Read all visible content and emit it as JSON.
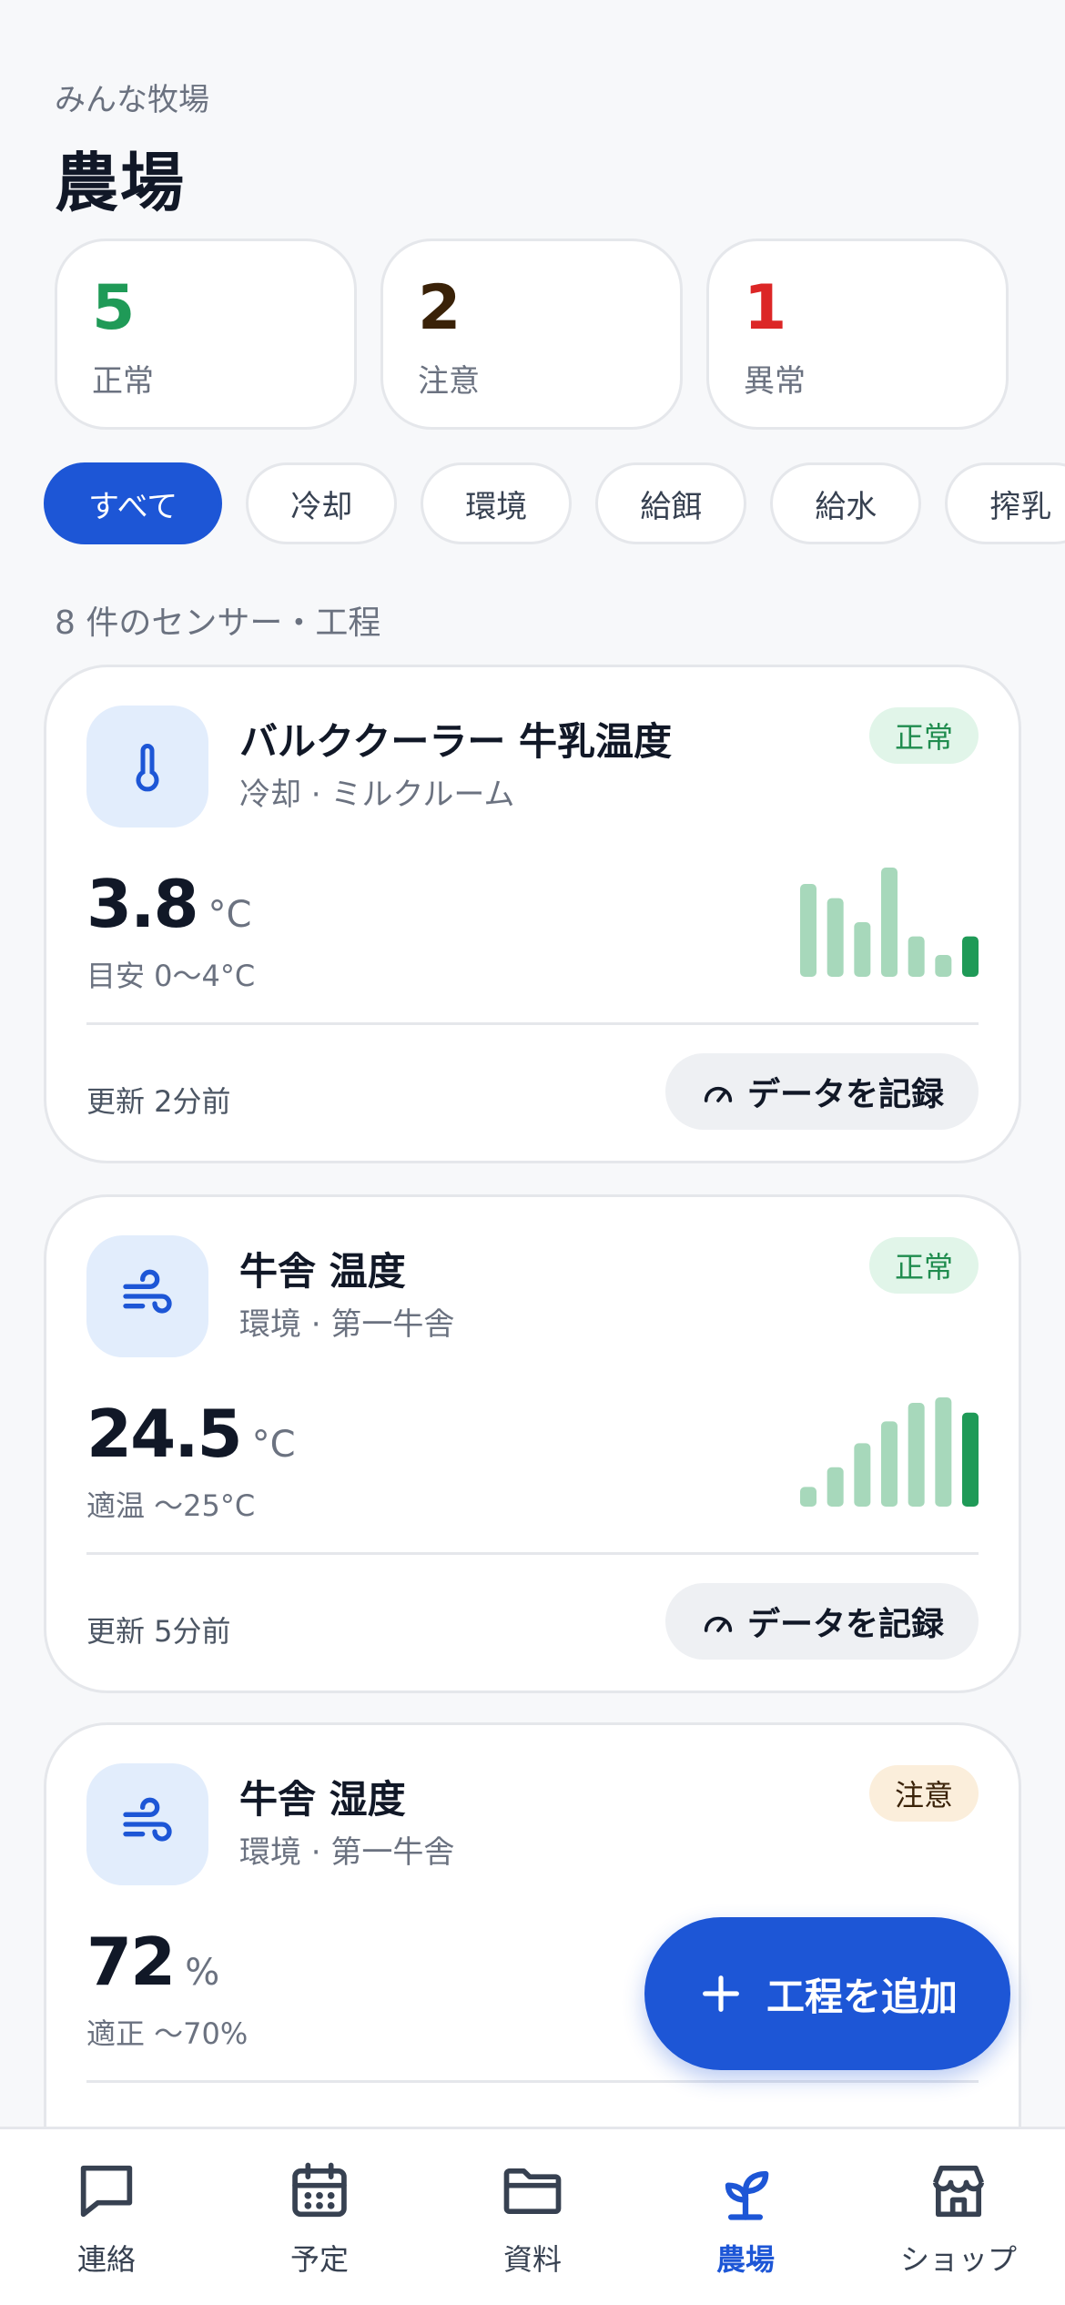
{
  "header": {
    "org": "みんな牧場",
    "title": "農場"
  },
  "stats": [
    {
      "value": "5",
      "label": "正常",
      "color": "#1f9a57"
    },
    {
      "value": "2",
      "label": "注意",
      "color": "#3a2208"
    },
    {
      "value": "1",
      "label": "異常",
      "color": "#dc2626"
    }
  ],
  "filters": [
    "すべて",
    "冷却",
    "環境",
    "給餌",
    "給水",
    "搾乳"
  ],
  "active_filter": "すべて",
  "count_label": "8 件のセンサー・工程",
  "cards": [
    {
      "icon": "thermometer-icon",
      "name": "バルククーラー 牛乳温度",
      "sub": "冷却 · ミルクルーム",
      "status": "正常",
      "status_kind": "ok",
      "value": "3.8",
      "unit": "°C",
      "range": "目安 0〜4°C",
      "trend": [
        0.85,
        0.72,
        0.5,
        1.0,
        0.37,
        0.2,
        0.37
      ],
      "updated": "更新 2分前",
      "action": "データを記録"
    },
    {
      "icon": "wind-icon",
      "name": "牛舎 温度",
      "sub": "環境 · 第一牛舎",
      "status": "正常",
      "status_kind": "ok",
      "value": "24.5",
      "unit": "°C",
      "range": "適温 〜25°C",
      "trend": [
        0.18,
        0.36,
        0.58,
        0.78,
        0.95,
        1.0,
        0.86
      ],
      "updated": "更新 5分前",
      "action": "データを記録"
    },
    {
      "icon": "wind-icon",
      "name": "牛舎 湿度",
      "sub": "環境 · 第一牛舎",
      "status": "注意",
      "status_kind": "warn",
      "value": "72",
      "unit": "%",
      "range": "適正 〜70%",
      "trend": [],
      "updated": "",
      "action": ""
    }
  ],
  "fab": {
    "label": "工程を追加"
  },
  "tabs": [
    {
      "label": "連絡",
      "icon": "chat-icon"
    },
    {
      "label": "予定",
      "icon": "calendar-icon"
    },
    {
      "label": "資料",
      "icon": "folder-icon"
    },
    {
      "label": "農場",
      "icon": "sprout-icon"
    },
    {
      "label": "ショップ",
      "icon": "shop-icon"
    }
  ],
  "active_tab": "農場",
  "colors": {
    "accent": "#1d56d6",
    "bar_light": "#a7d8bb",
    "bar_dark": "#1f9a57"
  }
}
